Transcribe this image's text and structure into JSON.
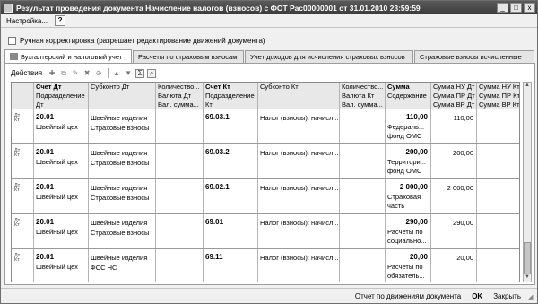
{
  "window": {
    "title": "Результат проведения документа Начисление налогов (взносов) с ФОТ Рас00000001 от 31.01.2010 23:59:59",
    "controls": [
      "_",
      "□",
      "x"
    ]
  },
  "menu": {
    "settings_label": "Настройка...",
    "help_label": "?"
  },
  "manual_checkbox": {
    "label": "Ручная корректировка (разрешает редактирование движений документа)",
    "checked": false
  },
  "tabs": [
    {
      "label": "Бухгалтерский и налоговый учет",
      "active": true
    },
    {
      "label": "Расчеты по страховым взносам",
      "active": false
    },
    {
      "label": "Учет доходов для исчисления страховых взносов",
      "active": false
    },
    {
      "label": "Страховые взносы исчисленные",
      "active": false
    }
  ],
  "toolbar": {
    "actions_label": "Действия"
  },
  "columns": {
    "dt": {
      "top": "Счет Дт",
      "mid": "Подразделение",
      "bot": "Дт"
    },
    "subdt": {
      "top": "Субконто Дт"
    },
    "qtydt": {
      "top": "Количество...",
      "mid": "Валюта Дт",
      "bot": "Вал. сумма..."
    },
    "kt": {
      "top": "Счет Кт",
      "mid": "Подразделение",
      "bot": "Кт"
    },
    "subkt": {
      "top": "Субконто Кт"
    },
    "qtykt": {
      "top": "Количество...",
      "mid": "Валюта Кт",
      "bot": "Вал. сумма..."
    },
    "sum": {
      "top": "Сумма",
      "mid": "Содержание"
    },
    "nudt": {
      "top": "Сумма НУ Дт",
      "mid": "Сумма ПР Дт",
      "bot": "Сумма ВР Дт"
    },
    "nukt": {
      "top": "Сумма НУ Кт",
      "mid": "Сумма ПР Кт",
      "bot": "Сумма ВР Кт"
    }
  },
  "rows": [
    {
      "icon": "Дт Кт",
      "dt": "20.01",
      "dept": "Швейный цех",
      "sub1": "Швейные изделия",
      "sub2": "Страховые взносы",
      "kt": "69.03.1",
      "subkt": "Налог (взносы): начисл...",
      "sum": "110,00",
      "content1": "Федераль...",
      "content2": "фонд ОМС",
      "nu": "110,00"
    },
    {
      "icon": "Дт Кт",
      "dt": "20.01",
      "dept": "Швейный цех",
      "sub1": "Швейные изделия",
      "sub2": "Страховые взносы",
      "kt": "69.03.2",
      "subkt": "Налог (взносы): начисл...",
      "sum": "200,00",
      "content1": "Территори...",
      "content2": "фонд ОМС",
      "nu": "200,00"
    },
    {
      "icon": "Дт Кт",
      "dt": "20.01",
      "dept": "Швейный цех",
      "sub1": "Швейные изделия",
      "sub2": "Страховые взносы",
      "kt": "69.02.1",
      "subkt": "Налог (взносы): начисл...",
      "sum": "2 000,00",
      "content1": "Страховая",
      "content2": "часть",
      "nu": "2 000,00"
    },
    {
      "icon": "Дт Кт",
      "dt": "20.01",
      "dept": "Швейный цех",
      "sub1": "Швейные изделия",
      "sub2": "Страховые взносы",
      "kt": "69.01",
      "subkt": "Налог (взносы): начисл...",
      "sum": "290,00",
      "content1": "Расчеты по",
      "content2": "социально...",
      "nu": "290,00"
    },
    {
      "icon": "Дт Кт",
      "dt": "20.01",
      "dept": "Швейный цех",
      "sub1": "Швейные изделия",
      "sub2": "ФСС НС",
      "kt": "69.11",
      "subkt": "Налог (взносы): начисл...",
      "sum": "20,00",
      "content1": "Расчеты по",
      "content2": "обязатель...",
      "nu": "20,00"
    }
  ],
  "footer": {
    "report_label": "Отчет по движениям документа",
    "ok_label": "OK",
    "close_label": "Закрыть"
  }
}
